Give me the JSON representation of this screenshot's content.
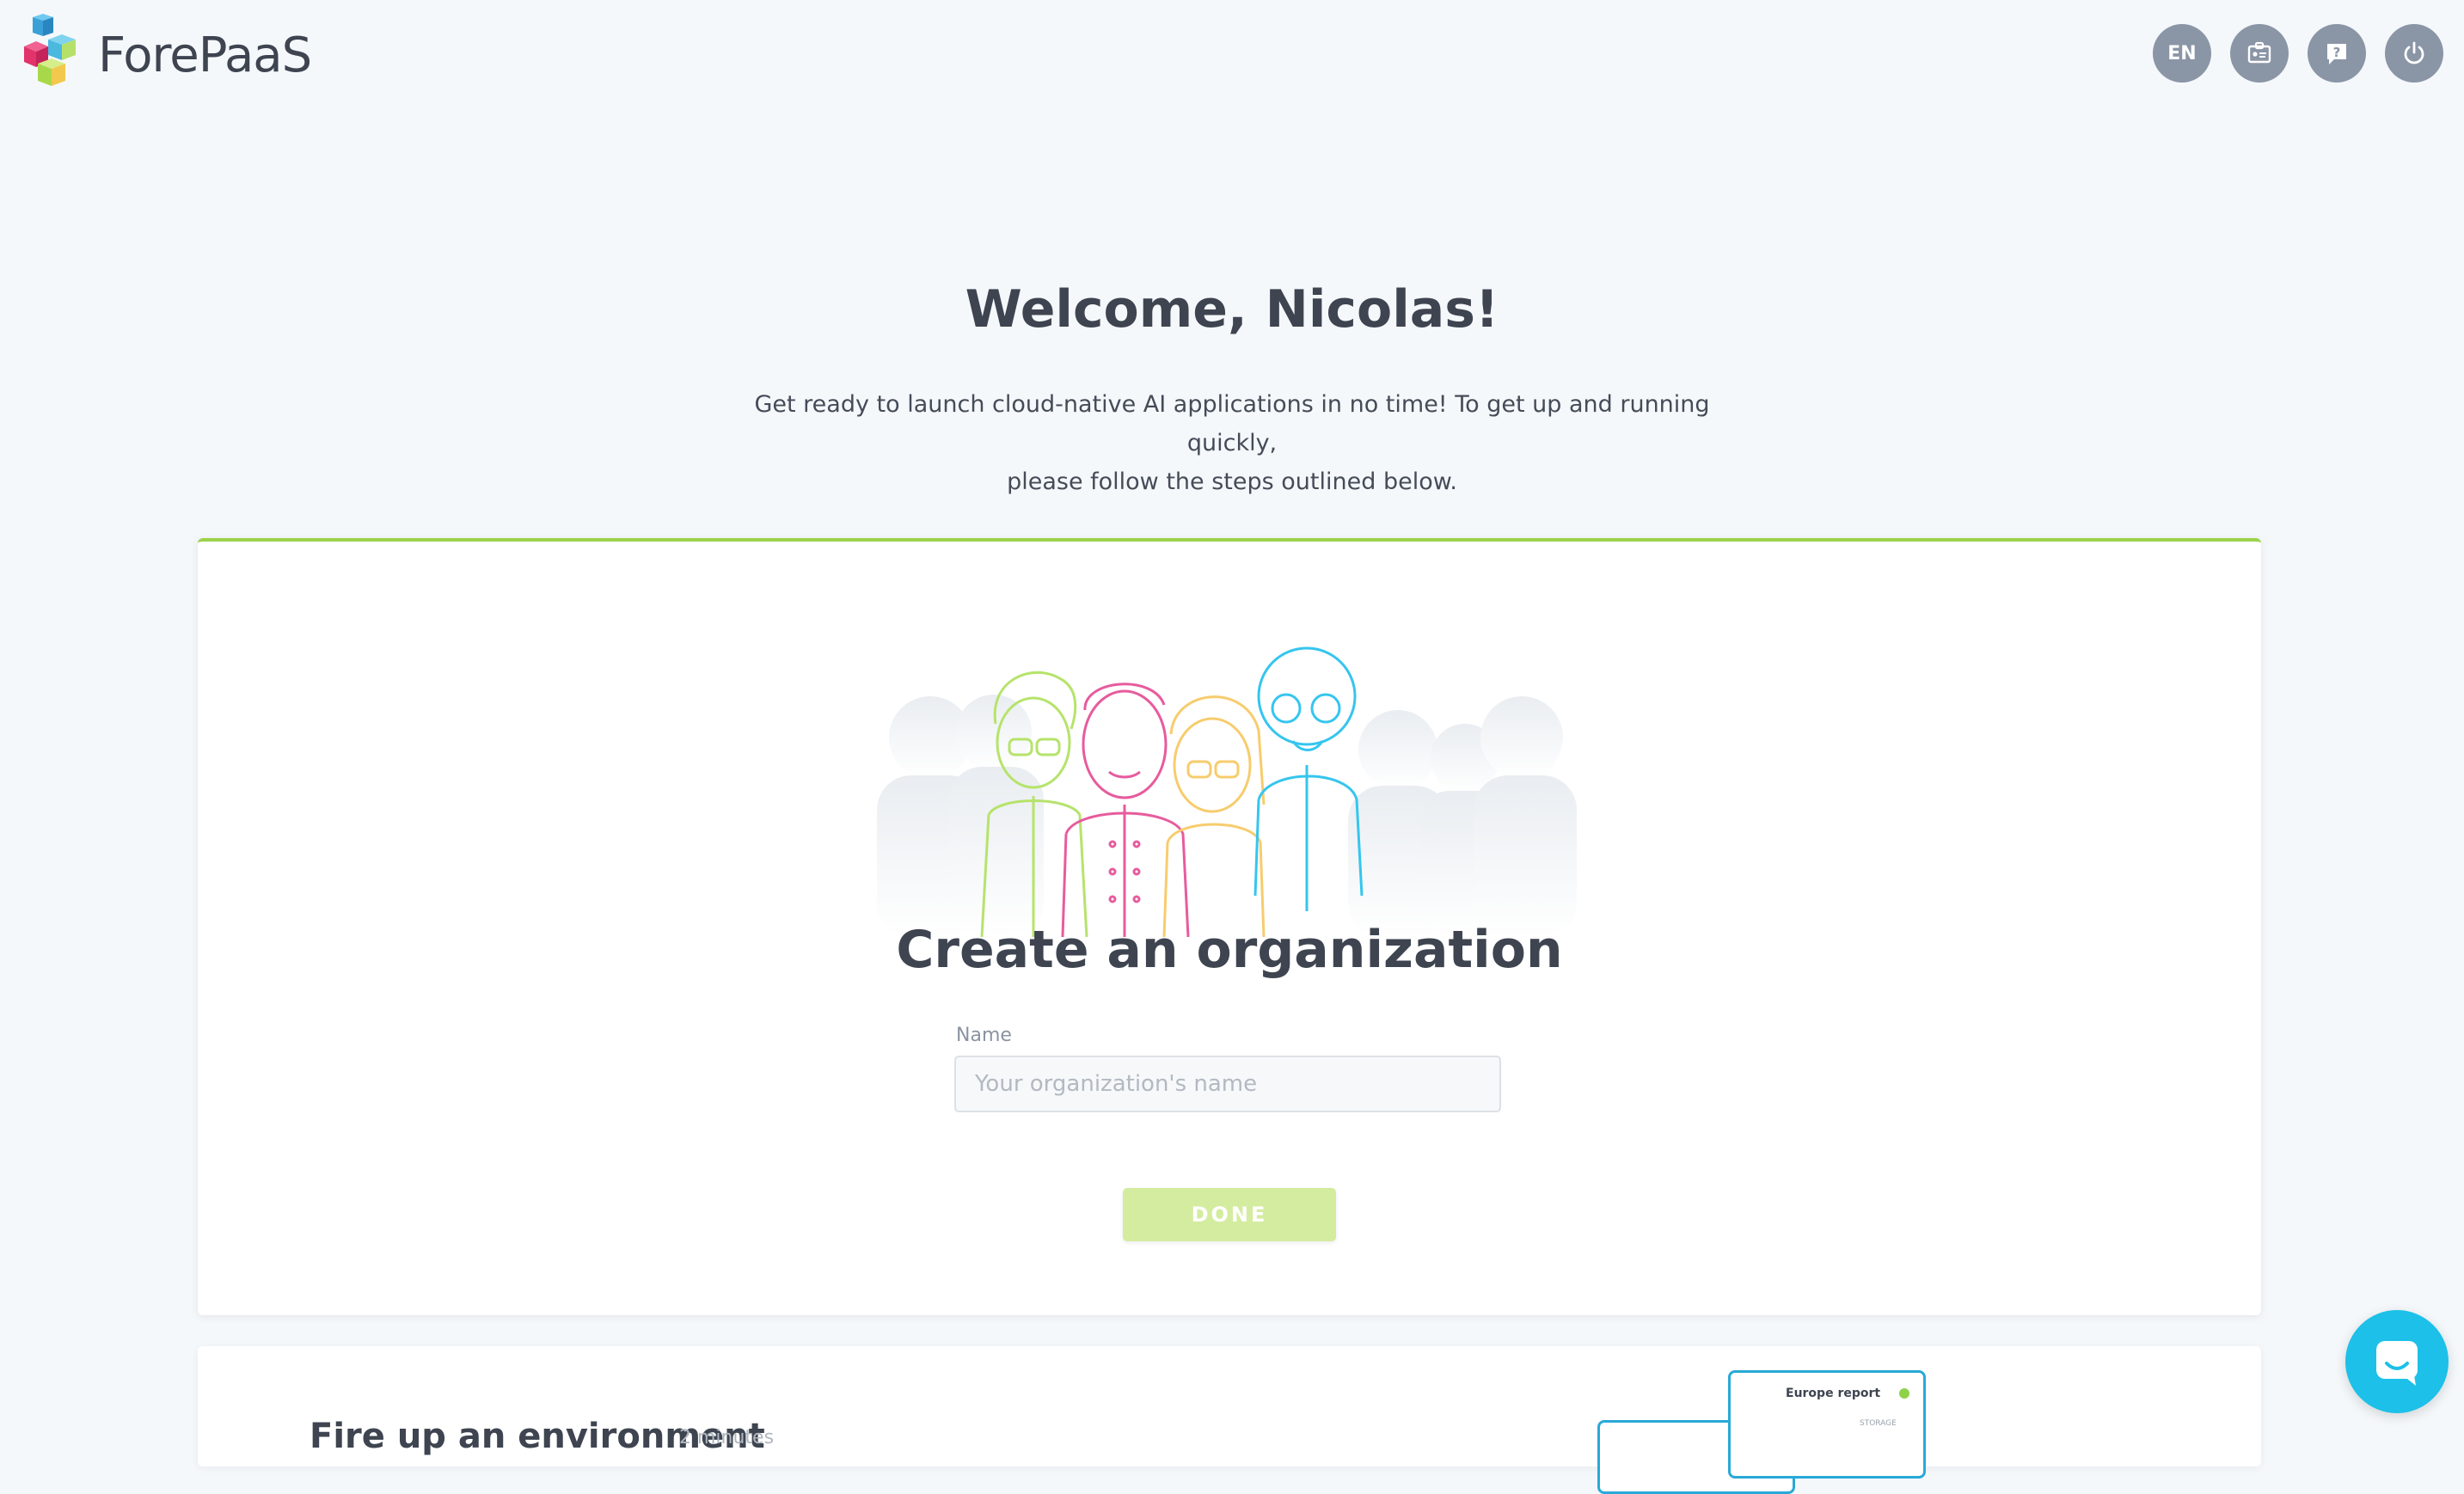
{
  "brand": {
    "name": "ForePaaS"
  },
  "header": {
    "language_label": "EN",
    "buttons": [
      "language",
      "id-card",
      "help",
      "power"
    ]
  },
  "welcome": {
    "title": "Welcome, Nicolas!",
    "subtitle_line1": "Get ready to launch cloud-native AI applications in no time! To get up and running quickly,",
    "subtitle_line2": "please follow the steps outlined below."
  },
  "organization_step": {
    "title": "Create an organization",
    "name_label": "Name",
    "name_value": "",
    "name_placeholder": "Your organization's name",
    "done_label": "DONE"
  },
  "environment_step": {
    "title": "Fire up an environment",
    "time_hint": "2 minutes",
    "preview_report_title": "Europe report",
    "preview_storage_label": "STORAGE"
  },
  "colors": {
    "accent_green": "#9bd24a",
    "done_disabled": "#d4ec9f",
    "chat": "#1cc0e8",
    "header_icon_bg": "#8a95a6"
  }
}
